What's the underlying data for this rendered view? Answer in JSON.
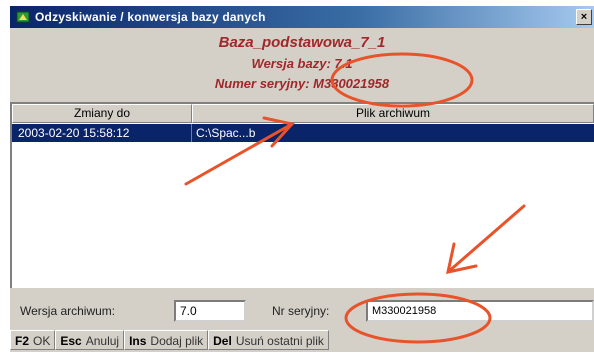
{
  "window": {
    "title": "Odzyskiwanie / konwersja bazy danych",
    "close_label": "×"
  },
  "info": {
    "name": "Baza_podstawowa_7_1",
    "version": "Wersja bazy: 7.1",
    "serial": "Numer seryjny: M330021958"
  },
  "list": {
    "columns": [
      "Zmiany do",
      "Plik archiwum"
    ],
    "rows": [
      {
        "date": "2003-02-20 15:58:12",
        "path": "C:\\Spac...b"
      }
    ]
  },
  "form": {
    "archive_version_label": "Wersja archiwum:",
    "archive_version_value": "7.0",
    "serial_label": "Nr seryjny:",
    "serial_value": "M330021958"
  },
  "fkeys": [
    {
      "key": "F2",
      "label": "OK"
    },
    {
      "key": "Esc",
      "label": "Anuluj"
    },
    {
      "key": "Ins",
      "label": "Dodaj plik"
    },
    {
      "key": "Del",
      "label": "Usuń ostatni plik"
    }
  ],
  "colors": {
    "title_bar": "#0a246a",
    "info_text": "#a0282a",
    "selection": "#0a246a",
    "annotation": "#e8532a"
  },
  "icons": {
    "title": "database-app-icon",
    "annotations": [
      "ellipse-annotation",
      "arrow-annotation"
    ]
  }
}
